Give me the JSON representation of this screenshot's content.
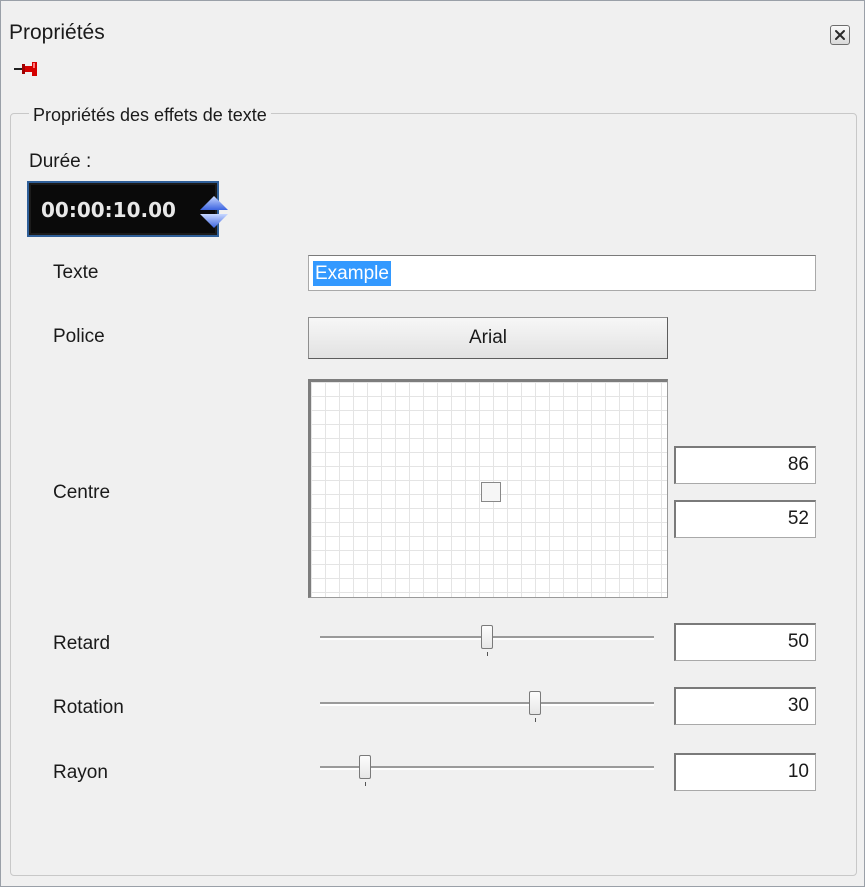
{
  "window": {
    "title": "Propriétés"
  },
  "icons": {
    "close": "close-icon",
    "pin": "pin-icon",
    "spin": "spin-arrows-icon"
  },
  "group": {
    "legend": "Propriétés des effets de texte"
  },
  "duration": {
    "label": "Durée :",
    "value": "00:00:10.00"
  },
  "text": {
    "label": "Texte",
    "value": "Example"
  },
  "font": {
    "label": "Police",
    "value": "Arial"
  },
  "center": {
    "label": "Centre",
    "x": "86",
    "y": "52"
  },
  "delay": {
    "label": "Retard",
    "value": "50",
    "level": 0.5
  },
  "rotation": {
    "label": "Rotation",
    "value": "30",
    "level": 0.65
  },
  "radius": {
    "label": "Rayon",
    "value": "10",
    "level": 0.12
  },
  "colors": {
    "selection": "#3399ff",
    "duration_bg": "#0a0a0a",
    "duration_border": "#2f5f99",
    "pin": "#d40000"
  }
}
